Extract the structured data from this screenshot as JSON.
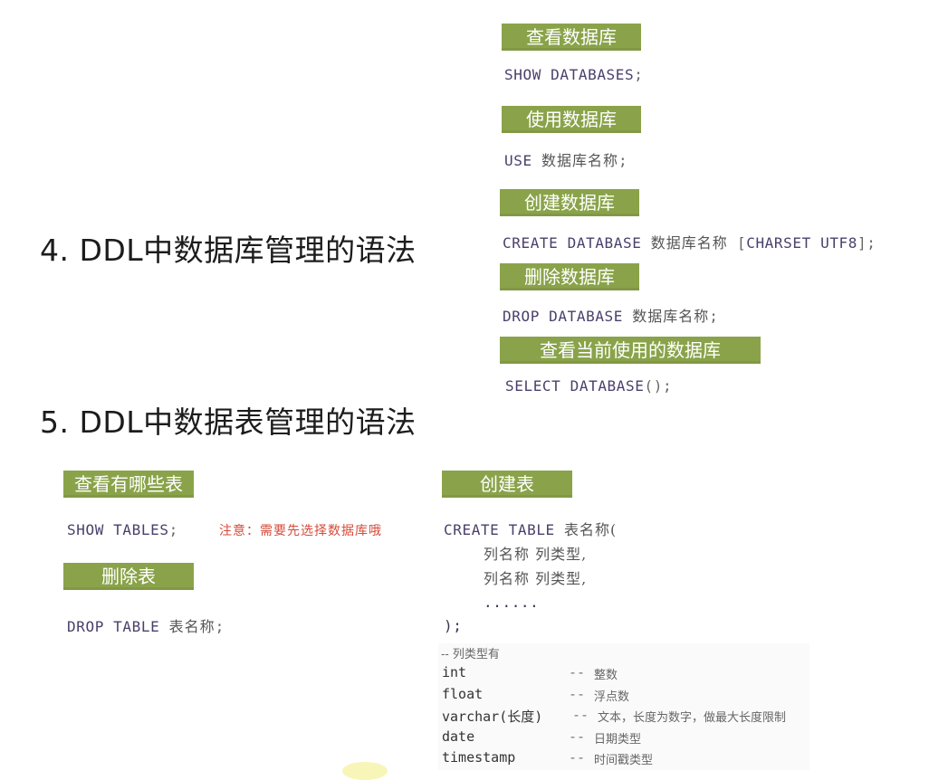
{
  "sections": [
    {
      "heading": "4. DDL中数据库管理的语法"
    },
    {
      "heading": "5. DDL中数据表管理的语法"
    }
  ],
  "db": {
    "show": {
      "label": "查看数据库",
      "kw": "SHOW DATABASES",
      "end": ";"
    },
    "use": {
      "label": "使用数据库",
      "kw": "USE",
      "name": "数据库名称",
      "end": ";"
    },
    "create": {
      "label": "创建数据库",
      "kw": "CREATE DATABASE",
      "name": "数据库名称",
      "lbr": "[",
      "kw2": "CHARSET UTF8",
      "rbr": "];"
    },
    "drop": {
      "label": "删除数据库",
      "kw": "DROP DATABASE",
      "name": "数据库名称",
      "end": ";"
    },
    "current": {
      "label": "查看当前使用的数据库",
      "kw": "SELECT DATABASE",
      "end": "();"
    }
  },
  "tbl": {
    "show": {
      "label": "查看有哪些表",
      "kw": "SHOW TABLES",
      "end": ";",
      "note": "注意：需要先选择数据库哦"
    },
    "drop": {
      "label": "删除表",
      "kw": "DROP TABLE",
      "name": "表名称",
      "end": ";"
    },
    "create": {
      "label": "创建表",
      "kw": "CREATE TABLE",
      "name": "表名称(",
      "col1": "列名称 列类型,",
      "col2": "列名称 列类型,",
      "ellipsis": "......",
      "close": ");"
    },
    "types": {
      "header": "-- 列类型有",
      "rows": [
        {
          "name": "int",
          "dash": "--",
          "desc": "整数"
        },
        {
          "name": "float",
          "dash": "--",
          "desc": "浮点数"
        },
        {
          "name": "varchar(长度)",
          "dash": "--",
          "desc": "文本，长度为数字，做最大长度限制"
        },
        {
          "name": "date",
          "dash": "--",
          "desc": "日期类型"
        },
        {
          "name": "timestamp",
          "dash": "--",
          "desc": "时间戳类型"
        }
      ]
    }
  },
  "colors": {
    "tag_bg": "#8aa34a",
    "note": "#d64b3a"
  }
}
